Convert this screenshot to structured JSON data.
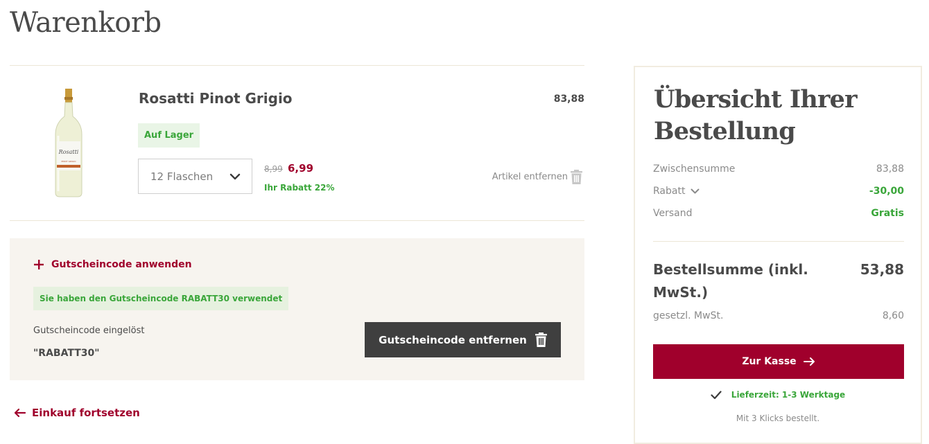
{
  "page": {
    "title": "Warenkorb"
  },
  "cart_item": {
    "name": "Rosatti Pinot Grigio",
    "total": "83,88",
    "stock": "Auf Lager",
    "quantity": "12 Flaschen",
    "old_price": "8,99",
    "new_price": "6,99",
    "discount": "Ihr Rabatt 22%",
    "remove_label": "Artikel entfernen",
    "bottle_label_brand": "Rosatti",
    "bottle_label_variety": "PINOT GRIGIO"
  },
  "coupon": {
    "toggle_label": "Gutscheincode anwenden",
    "success_message": "Sie haben den Gutscheincode RABATT30 verwendet",
    "redeemed_label": "Gutscheincode eingelöst",
    "code": "\"RABATT30\"",
    "remove_button": "Gutscheincode entfernen"
  },
  "continue_shopping": "Einkauf fortsetzen",
  "summary": {
    "title": "Übersicht Ihrer Bestellung",
    "subtotal_label": "Zwischensumme",
    "subtotal_value": "83,88",
    "discount_label": "Rabatt",
    "discount_value": "-30,00",
    "shipping_label": "Versand",
    "shipping_value": "Gratis",
    "total_label": "Bestellsumme (inkl. MwSt.)",
    "total_value": "53,88",
    "vat_label": "gesetzl. MwSt.",
    "vat_value": "8,60",
    "checkout_button": "Zur Kasse",
    "delivery": "Lieferzeit: 1-3 Werktage",
    "clicks_note": "Mit 3 Klicks bestellt."
  },
  "colors": {
    "brand": "#a0002c",
    "success": "#3aa63a",
    "dark_button": "#3f3f3f",
    "coupon_bg": "#f7f4ef"
  },
  "icons": [
    "trash-icon",
    "chevron-down-icon",
    "plus-icon",
    "arrow-left-icon",
    "arrow-right-icon",
    "checkmark-icon"
  ]
}
